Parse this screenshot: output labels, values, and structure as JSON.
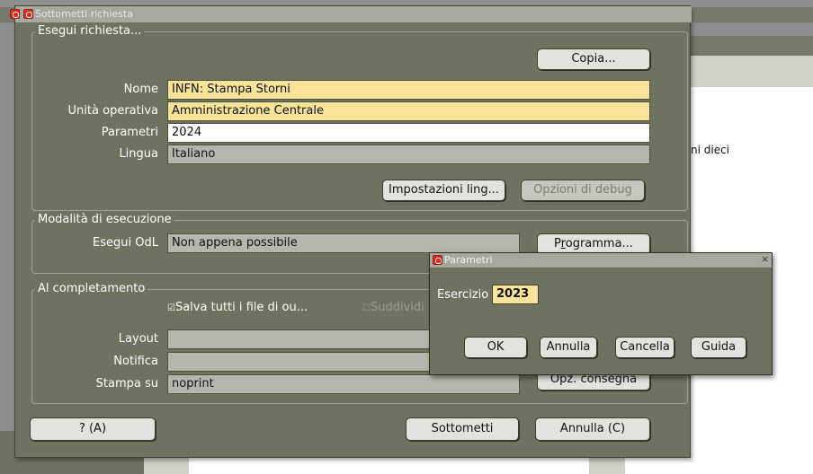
{
  "background_window": {
    "fragment_text": "ni dieci",
    "close_glyphs": "×⊓×"
  },
  "main_dialog": {
    "title": "Sottometti richiesta",
    "run_group": {
      "title": "Esegui richiesta...",
      "copy_button": "Copia...",
      "name_label": "Nome",
      "name_value": "INFN: Stampa Storni",
      "unit_label": "Unità operativa",
      "unit_value": "Amministrazione Centrale",
      "params_label": "Parametri",
      "params_value": "2024",
      "language_label": "Lingua",
      "language_value": "Italiano",
      "language_settings_button": "Impostazioni ling...",
      "debug_button": "Opzioni di debug"
    },
    "schedule_group": {
      "title": "Modalità di esecuzione",
      "run_label": "Esegui OdL",
      "run_value": "Non appena possibile",
      "schedule_button_pre": "P",
      "schedule_button_u": "r",
      "schedule_button_post": "ogramma..."
    },
    "completion_group": {
      "title": "Al completamento",
      "save_checkbox_label": "Salva tutti i file di ou...",
      "split_checkbox_label": "Suddividi",
      "layout_label": "Layout",
      "notify_label": "Notifica",
      "print_label": "Stampa su",
      "print_value": "noprint",
      "delivery_button": "Opz. consegna"
    },
    "help_button": "? (A)",
    "submit_button": "Sottometti",
    "cancel_button": "Annulla (C)"
  },
  "param_dialog": {
    "title": "Parametri",
    "esercizio_label": "Esercizio",
    "esercizio_value": "2023",
    "ok_button": "OK",
    "annulla_button": "Annulla",
    "cancella_button": "Cancella",
    "guida_button": "Guida",
    "close_glyph": "×"
  }
}
